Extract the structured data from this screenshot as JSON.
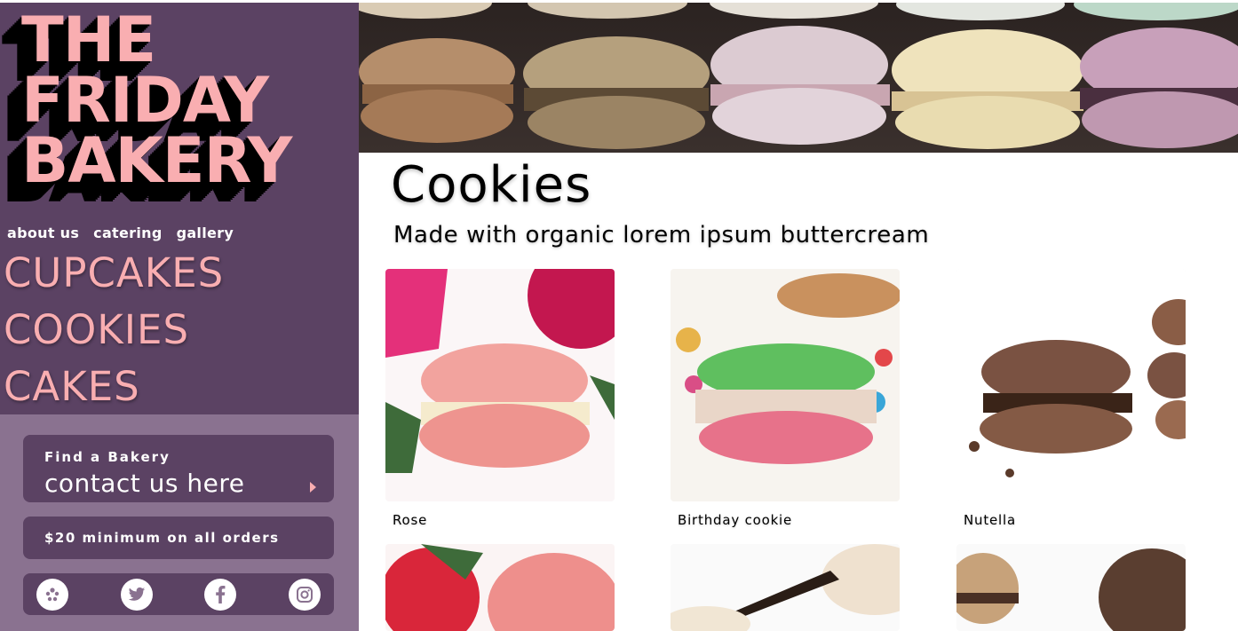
{
  "logo": {
    "line1": "THE",
    "line2": "FRIDAY",
    "line3": "BAKERY"
  },
  "nav": {
    "small": [
      "about us",
      "catering",
      "gallery"
    ],
    "big": [
      "CUPCAKES",
      "COOKIES",
      "CAKES"
    ]
  },
  "find_bakery": {
    "label": "Find a Bakery",
    "link": "contact us here"
  },
  "notice": "$20 minimum on all orders",
  "social": [
    "yelp-icon",
    "twitter-icon",
    "facebook-icon",
    "instagram-icon"
  ],
  "page": {
    "title": "Cookies",
    "subtitle": "Made with organic lorem ipsum buttercream"
  },
  "products": [
    {
      "name": "Rose",
      "color": "#f0908e",
      "filling": "#f6ecc8"
    },
    {
      "name": "Birthday cookie",
      "color": "#5fbf5f",
      "filling": "#e9d6c8"
    },
    {
      "name": "Nutella",
      "color": "#7a5242",
      "filling": "#3a2418"
    }
  ],
  "colors": {
    "sidebar": "#5b4263",
    "sidebar_lower": "#8a7290",
    "accent_pink": "#f9aeb1"
  }
}
